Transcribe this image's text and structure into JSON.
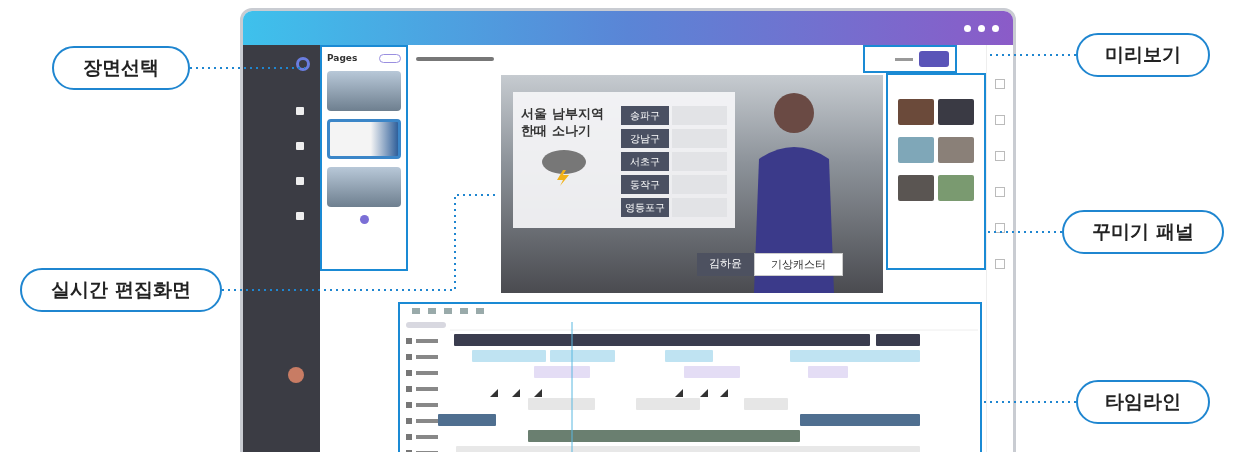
{
  "callouts": [
    {
      "label": "장면선택"
    },
    {
      "label": "미리보기"
    },
    {
      "label": "실시간 편집화면"
    },
    {
      "label": "꾸미기 패널"
    },
    {
      "label": "타임라인"
    }
  ],
  "pages_panel": {
    "title": "Pages",
    "thumbnails": [
      {
        "selected": false
      },
      {
        "selected": true
      },
      {
        "selected": false
      }
    ]
  },
  "weather_card": {
    "headline": "서울 남부지역 한때 소나기",
    "districts": [
      "송파구",
      "강남구",
      "서초구",
      "동작구",
      "영등포구"
    ]
  },
  "name_tag": {
    "name": "김하윤",
    "role": "기상캐스터"
  }
}
